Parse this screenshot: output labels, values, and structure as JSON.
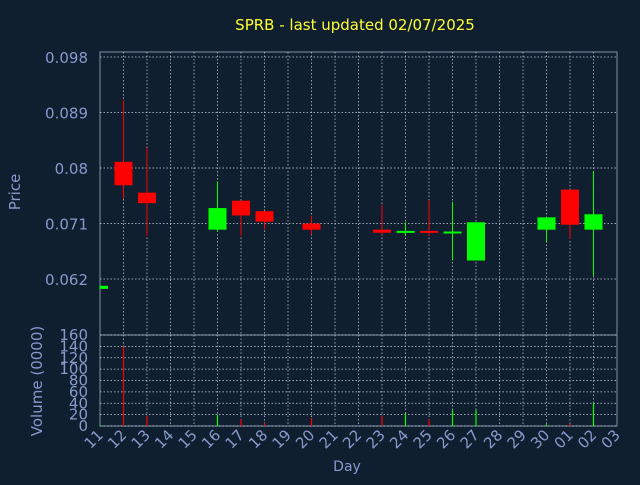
{
  "chart_data": [
    {
      "type": "candlestick",
      "title": "SPRB - last updated 02/07/2025",
      "ylabel": "Price",
      "ylim": [
        0.056,
        0.098
      ],
      "yticks": [
        "0.098",
        "0.089",
        "0.08",
        "0.071",
        "0.062"
      ],
      "ytick_values": [
        0.098,
        0.089,
        0.08,
        0.071,
        0.062
      ],
      "grid": true,
      "up_color": "#00ff00",
      "down_color": "#ff0000",
      "candles": [
        {
          "day": "11",
          "open": 0.0604,
          "high": 0.061,
          "low": 0.0603,
          "close": 0.0609
        },
        {
          "day": "12",
          "open": 0.081,
          "high": 0.091,
          "low": 0.075,
          "close": 0.0772
        },
        {
          "day": "13",
          "open": 0.076,
          "high": 0.0833,
          "low": 0.069,
          "close": 0.0743
        },
        {
          "day": "16",
          "open": 0.07,
          "high": 0.0778,
          "low": 0.0697,
          "close": 0.0735
        },
        {
          "day": "17",
          "open": 0.0747,
          "high": 0.0747,
          "low": 0.069,
          "close": 0.0723
        },
        {
          "day": "18",
          "open": 0.073,
          "high": 0.073,
          "low": 0.07,
          "close": 0.0713
        },
        {
          "day": "20",
          "open": 0.071,
          "high": 0.0722,
          "low": 0.0692,
          "close": 0.07
        },
        {
          "day": "23",
          "open": 0.07,
          "high": 0.074,
          "low": 0.0692,
          "close": 0.0695
        },
        {
          "day": "24",
          "open": 0.0695,
          "high": 0.0712,
          "low": 0.069,
          "close": 0.0698
        },
        {
          "day": "25",
          "open": 0.0698,
          "high": 0.0748,
          "low": 0.069,
          "close": 0.0695
        },
        {
          "day": "26",
          "open": 0.0695,
          "high": 0.0745,
          "low": 0.065,
          "close": 0.0697
        },
        {
          "day": "27",
          "open": 0.065,
          "high": 0.0712,
          "low": 0.065,
          "close": 0.0712
        },
        {
          "day": "30",
          "open": 0.07,
          "high": 0.072,
          "low": 0.068,
          "close": 0.072
        },
        {
          "day": "01",
          "open": 0.0765,
          "high": 0.0765,
          "low": 0.0685,
          "close": 0.0708
        },
        {
          "day": "02",
          "open": 0.07,
          "high": 0.0795,
          "low": 0.0625,
          "close": 0.0725
        }
      ]
    },
    {
      "type": "bar",
      "xlabel": "Day",
      "ylabel": "Volume (0000)",
      "ylim": [
        0,
        160
      ],
      "yticks": [
        "160",
        "140",
        "120",
        "100",
        "80",
        "60",
        "40",
        "20",
        "0"
      ],
      "ytick_values": [
        160,
        140,
        120,
        100,
        80,
        60,
        40,
        20,
        0
      ],
      "categories": [
        "11",
        "12",
        "13",
        "14",
        "15",
        "16",
        "17",
        "18",
        "19",
        "20",
        "21",
        "22",
        "23",
        "24",
        "25",
        "26",
        "27",
        "28",
        "29",
        "30",
        "01",
        "02",
        "03"
      ],
      "bars": [
        {
          "day": "11",
          "value": 1,
          "color": "#00ff00"
        },
        {
          "day": "12",
          "value": 140,
          "color": "#ff0000"
        },
        {
          "day": "13",
          "value": 18,
          "color": "#ff0000"
        },
        {
          "day": "16",
          "value": 20,
          "color": "#00ff00"
        },
        {
          "day": "17",
          "value": 12,
          "color": "#ff0000"
        },
        {
          "day": "18",
          "value": 5,
          "color": "#ff0000"
        },
        {
          "day": "20",
          "value": 14,
          "color": "#ff0000"
        },
        {
          "day": "23",
          "value": 18,
          "color": "#ff0000"
        },
        {
          "day": "24",
          "value": 22,
          "color": "#00ff00"
        },
        {
          "day": "25",
          "value": 12,
          "color": "#ff0000"
        },
        {
          "day": "26",
          "value": 28,
          "color": "#00ff00"
        },
        {
          "day": "27",
          "value": 28,
          "color": "#00ff00"
        },
        {
          "day": "30",
          "value": 3,
          "color": "#00ff00"
        },
        {
          "day": "01",
          "value": 4,
          "color": "#ff0000"
        },
        {
          "day": "02",
          "value": 40,
          "color": "#00ff00"
        }
      ]
    }
  ]
}
